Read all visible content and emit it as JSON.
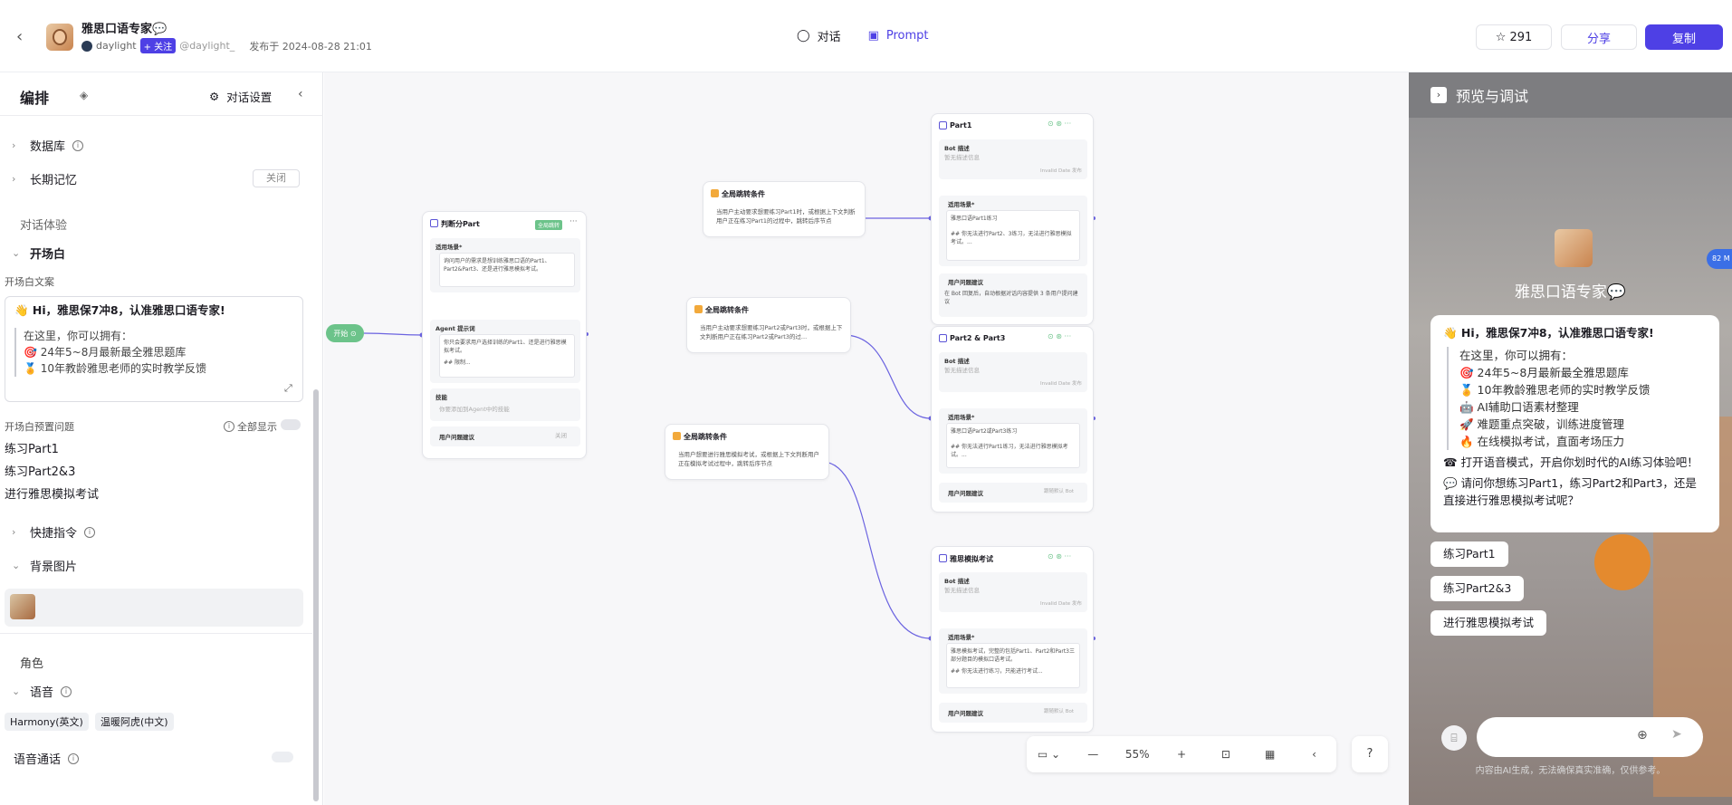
{
  "header": {
    "bot_name": "雅思口语专家💬",
    "author": "daylight",
    "follow_label": "+ 关注",
    "handle": "@daylight_",
    "published": "发布于 2024-08-28 21:01",
    "tab_chat": "对话",
    "tab_prompt": "Prompt",
    "stars": "291",
    "share": "分享",
    "copy": "复制"
  },
  "left": {
    "title": "编排",
    "chat_settings": "对话设置",
    "database": "数据库",
    "long_memory": "长期记忆",
    "long_memory_state": "关闭",
    "dialog_exp": "对话体验",
    "opener": "开场白",
    "opener_text_label": "开场白文案",
    "opener_line1": "👋 Hi，雅思保7冲8，认准雅思口语专家!",
    "opener_line2": "在这里，你可以拥有：",
    "opener_line3": "🎯 24年5~8月最新最全雅思题库",
    "opener_line4": "🏅 10年教龄雅思老师的实时教学反馈",
    "preset_label": "开场白预置问题",
    "show_all": "全部显示",
    "q1": "练习Part1",
    "q2": "练习Part2&3",
    "q3": "进行雅思模拟考试",
    "shortcut": "快捷指令",
    "bg_image": "背景图片",
    "role": "角色",
    "voice": "语音",
    "voice_en": "Harmony(英文)",
    "voice_cn": "温暖阿虎(中文)",
    "voice_call": "语音通话"
  },
  "canvas": {
    "start": "开始",
    "judge": "判断分Part",
    "judge_tag": "全局跳转",
    "scene": "适用场景*",
    "judge_scene_text": "询问用户的需求是想训练雅思口语的Part1、Part2&Part3、还是进行雅思模拟考试。",
    "agent_prompt": "Agent 提示词",
    "agent_text": "你只会要求用户选择训练的Part1、还是进行雅思模拟考试。",
    "agent_more": "## 限制...",
    "skills": "技能",
    "skills_placeholder": "你要添加到Agent中的技能",
    "user_suggest": "用户问题建议",
    "close": "关闭",
    "jump": "全局跳转条件",
    "jump1_text": "当用户主动要求想要练习Part1时，或根据上下文判断用户正在练习Part1的过程中，跳转后序节点",
    "jump2_text": "当用户主动要求想要练习Part2或Part3时，或根据上下文判断用户正在练习Part2或Part3的过...",
    "jump3_text": "当用户想要进行雅思模拟考试，或根据上下文判断用户正在模拟考试过程中，跳转后序节点",
    "part1": "Part1",
    "part23": "Part2 & Part3",
    "mock": "雅思模拟考试",
    "bot_desc": "Bot 描述",
    "bot_desc_ph": "暂无描述信息",
    "invalid": "Invalid Date 发布",
    "part1_scene": "雅思口语Part1练习",
    "part1_rule": "## 你无法进行Part2、3练习，无法进行雅思模拟考试。...",
    "part1_suggest": "在 Bot 回复后，自动根据对话内容提供 3 条用户提问建议",
    "part23_scene": "雅思口语Part2或Part3练习",
    "part23_rule": "## 你无法进行Part1练习，无法进行雅思模拟考试。...",
    "mock_scene": "雅思模拟考试，完整的包括Part1、Part2和Part3三部分题目的模拟口语考试。",
    "mock_rule": "## 你无法进行练习，只能进行考试...",
    "follow_bot": "跟随默认 Bot",
    "zoom": "55%"
  },
  "preview": {
    "title": "预览与调试",
    "bot_name": "雅思口语专家💬",
    "greet": "👋 Hi，雅思保7冲8，认准雅思口语专家!",
    "intro": "在这里，你可以拥有：",
    "item1": "🎯 24年5~8月最新最全雅思题库",
    "item2": "🏅 10年教龄雅思老师的实时教学反馈",
    "item3": "🤖 AI辅助口语素材整理",
    "item4": "🚀 难题重点突破，训练进度管理",
    "item5": "🔥 在线模拟考试，直面考场压力",
    "voice_line": "☎ 打开语音模式，开启你划时代的AI练习体验吧！",
    "ask": "💬 请问你想练习Part1，练习Part2和Part3，还是直接进行雅思模拟考试呢？",
    "s1": "练习Part1",
    "s2": "练习Part2&3",
    "s3": "进行雅思模拟考试",
    "disclaimer": "内容由AI生成，无法确保真实准确，仅供参考。"
  },
  "badge": "82 M"
}
